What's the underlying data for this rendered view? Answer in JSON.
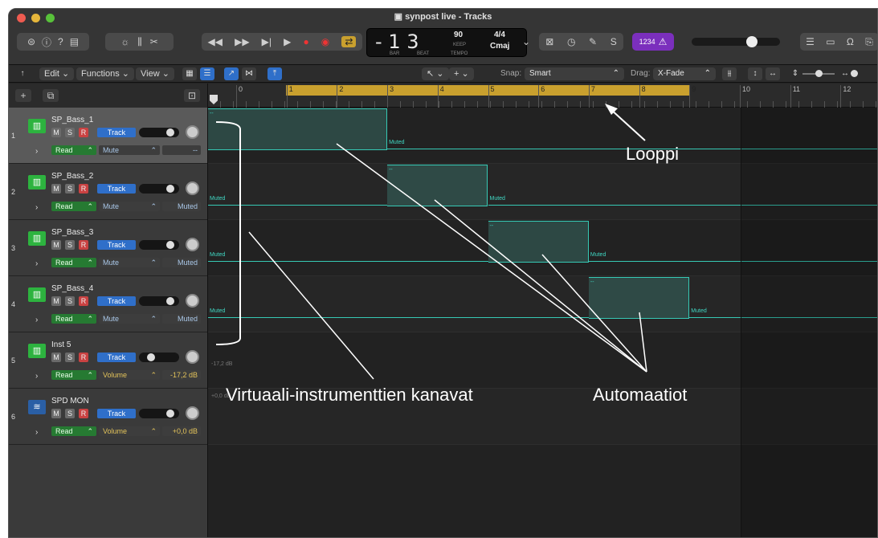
{
  "window": {
    "title": "synpost live - Tracks"
  },
  "transport": {
    "bar": "1",
    "beat": "3",
    "prefix": "-",
    "bar_label": "BAR",
    "beat_label": "BEAT",
    "tempo": "90",
    "tempo_mode": "KEEP",
    "tempo_label": "TEMPO",
    "signature": "4/4",
    "key": "Cmaj",
    "count_in": "1234"
  },
  "controlbar": {
    "edit": "Edit",
    "functions": "Functions",
    "view": "View",
    "snap_label": "Snap:",
    "snap_value": "Smart",
    "drag_label": "Drag:",
    "drag_value": "X-Fade"
  },
  "ruler": {
    "bars": [
      "0",
      "1",
      "2",
      "3",
      "4",
      "5",
      "6",
      "7",
      "8",
      "9",
      "10",
      "11",
      "12"
    ]
  },
  "tracks": [
    {
      "num": "1",
      "name": "SP_Bass_1",
      "m": "M",
      "s": "S",
      "r": "R",
      "tag": "Track",
      "mode": "Read",
      "param": "Mute",
      "value": "--",
      "icon": "synth-icon"
    },
    {
      "num": "2",
      "name": "SP_Bass_2",
      "m": "M",
      "s": "S",
      "r": "R",
      "tag": "Track",
      "mode": "Read",
      "param": "Mute",
      "value": "Muted",
      "icon": "synth-icon"
    },
    {
      "num": "3",
      "name": "SP_Bass_3",
      "m": "M",
      "s": "S",
      "r": "R",
      "tag": "Track",
      "mode": "Read",
      "param": "Mute",
      "value": "Muted",
      "icon": "synth-icon"
    },
    {
      "num": "4",
      "name": "SP_Bass_4",
      "m": "M",
      "s": "S",
      "r": "R",
      "tag": "Track",
      "mode": "Read",
      "param": "Mute",
      "value": "Muted",
      "icon": "synth-icon"
    },
    {
      "num": "5",
      "name": "Inst 5",
      "m": "M",
      "s": "S",
      "r": "R",
      "tag": "Track",
      "mode": "Read",
      "param": "Volume",
      "value": "-17,2 dB",
      "icon": "synth-icon"
    },
    {
      "num": "6",
      "name": "SPD MON",
      "m": "M",
      "s": "S",
      "r": "R",
      "tag": "Track",
      "mode": "Read",
      "param": "Volume",
      "value": "+0,0 dB",
      "icon": "audio-wave-icon"
    }
  ],
  "lane_labels": {
    "muted": "Muted",
    "dash": "--",
    "vol5": "-17,2 dB",
    "vol6": "+0,0 dB"
  },
  "annotations": {
    "loop": "Looppi",
    "channels": "Virtuaali-instrumenttien kanavat",
    "automation": "Automaatiot"
  },
  "colors": {
    "loop": "#c9a02e",
    "automation": "#36c9b5",
    "track_tag": "#2f6fc9",
    "read": "#267a32",
    "record": "#c94242"
  }
}
